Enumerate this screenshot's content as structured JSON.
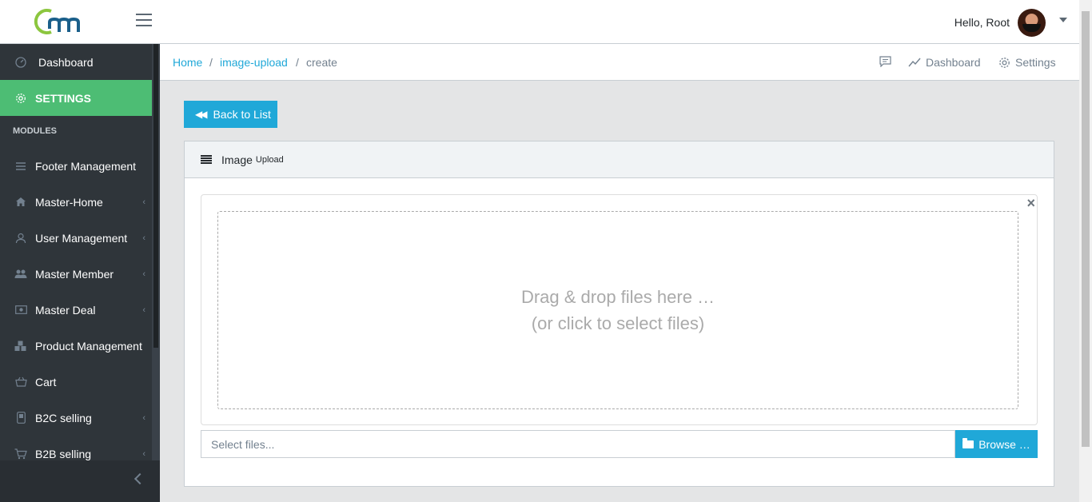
{
  "header": {
    "greeting": "Hello, Root",
    "logo_alt": "Cm logo"
  },
  "sidebar": {
    "items": [
      {
        "label": "Dashboard",
        "icon": "speedometer-icon",
        "has_children": false
      },
      {
        "label": "SETTINGS",
        "icon": "gear-icon",
        "has_children": false,
        "active": true
      },
      {
        "label": "Footer Management",
        "icon": "menu-icon",
        "has_children": false
      },
      {
        "label": "Master-Home",
        "icon": "home-icon",
        "has_children": true
      },
      {
        "label": "User Management",
        "icon": "user-icon",
        "has_children": true
      },
      {
        "label": "Master Member",
        "icon": "people-icon",
        "has_children": true
      },
      {
        "label": "Master Deal",
        "icon": "money-icon",
        "has_children": true
      },
      {
        "label": "Product Management",
        "icon": "cubes-icon",
        "has_children": true
      },
      {
        "label": "Cart",
        "icon": "basket-icon",
        "has_children": false
      },
      {
        "label": "B2C selling",
        "icon": "phone-icon",
        "has_children": true
      },
      {
        "label": "B2B selling",
        "icon": "cart-icon",
        "has_children": true
      }
    ],
    "section_title": "MODULES"
  },
  "breadcrumb": {
    "items": [
      "Home",
      "image-upload",
      "create"
    ],
    "separator": "/",
    "menu": {
      "dashboard": "Dashboard",
      "settings": "Settings"
    }
  },
  "content": {
    "back_button": "Back to List",
    "card_title": "Image",
    "card_title_small": "Upload",
    "drop_line1": "Drag & drop files here …",
    "drop_line2": "(or click to select files)",
    "file_placeholder": "Select files...",
    "browse_button": "Browse …",
    "close_symbol": "×"
  },
  "colors": {
    "primary": "#20a8d8",
    "active_green": "#4dbd74",
    "sidebar_bg": "#2f353a"
  }
}
